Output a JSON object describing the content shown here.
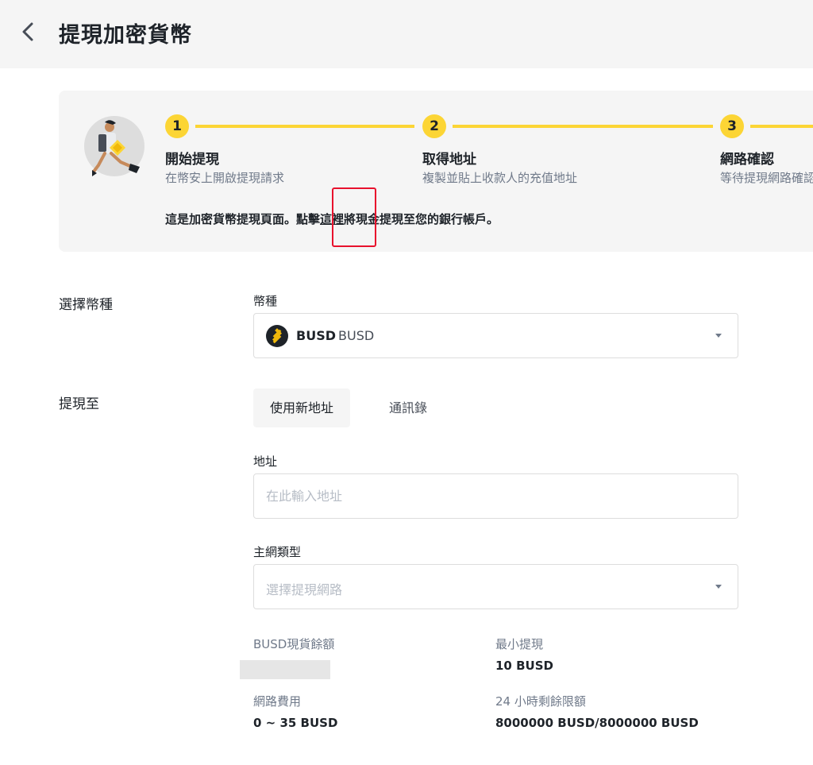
{
  "header": {
    "title": "提現加密貨幣"
  },
  "steps": [
    {
      "number": "1",
      "title": "開始提現",
      "desc": "在幣安上開啟提現請求"
    },
    {
      "number": "2",
      "title": "取得地址",
      "desc": "複製並貼上收款人的充值地址"
    },
    {
      "number": "3",
      "title": "網路確認",
      "desc": "等待提現網路確認"
    }
  ],
  "notice": {
    "prefix": "這是加密貨幣提現頁面。點擊",
    "link": "這裡",
    "suffix": "將現金提現至您的銀行帳戶。"
  },
  "coin_section": {
    "label": "選擇幣種",
    "field_label": "幣種",
    "selected_symbol": "BUSD",
    "selected_name": "BUSD"
  },
  "withdraw_section": {
    "label": "提現至",
    "tabs": [
      "使用新地址",
      "通訊錄"
    ],
    "address_label": "地址",
    "address_placeholder": "在此輸入地址",
    "network_label": "主網類型",
    "network_placeholder": "選擇提現網路"
  },
  "info": {
    "balance_label": "BUSD現貨餘額",
    "min_label": "最小提現",
    "min_value": "10 BUSD",
    "fee_label": "網路費用",
    "fee_value": "0 ~ 35 BUSD",
    "limit_label": "24 小時剩餘限額",
    "limit_value": "8000000 BUSD/8000000 BUSD"
  },
  "colors": {
    "accent": "#fcd535",
    "highlight": "#e8112d",
    "panel_bg": "#f5f5f5",
    "text_primary": "#1e2329",
    "text_secondary": "#707a8a"
  },
  "icons": {
    "back": "chevron-left-icon",
    "coin": "busd-coin-icon",
    "dropdown": "caret-down-icon"
  }
}
